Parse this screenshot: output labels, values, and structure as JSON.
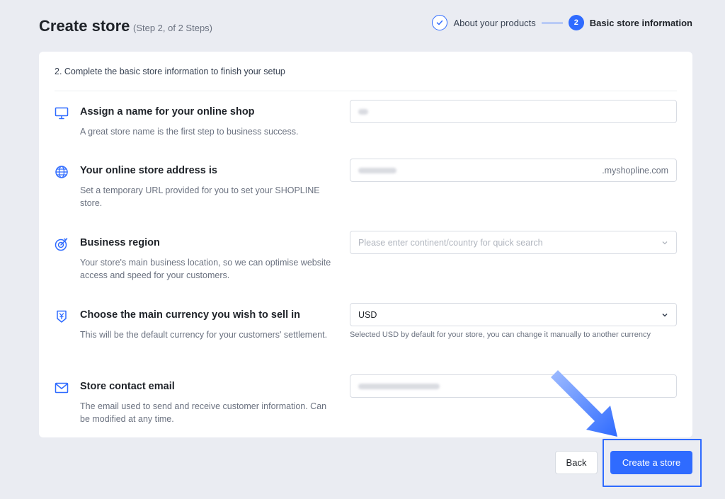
{
  "header": {
    "title": "Create store",
    "step_text": "(Step 2, of 2 Steps)"
  },
  "stepper": {
    "steps": [
      {
        "label": "About your products",
        "status": "done",
        "icon": "check-icon"
      },
      {
        "label": "Basic store information",
        "status": "active",
        "number": "2"
      }
    ]
  },
  "form": {
    "intro": "2. Complete the basic store information to finish your setup",
    "fields": [
      {
        "icon": "monitor-icon",
        "title": "Assign a name for your online shop",
        "description": "A great store name is the first step to business success.",
        "value": ""
      },
      {
        "icon": "globe-icon",
        "title": "Your online store address is",
        "description": "Set a temporary URL provided for you to set your SHOPLINE store.",
        "value": "",
        "suffix": ".myshopline.com"
      },
      {
        "icon": "target-icon",
        "title": "Business region",
        "description": "Your store's main business location, so we can optimise website access and speed for your customers.",
        "placeholder": "Please enter continent/country for quick search"
      },
      {
        "icon": "currency-icon",
        "title": "Choose the main currency you wish to sell in",
        "description": "This will be the default currency for your customers' settlement.",
        "value": "USD",
        "hint": "Selected USD by default for your store, you can change it manually to another currency"
      },
      {
        "icon": "mail-icon",
        "title": "Store contact email",
        "description": "The email used to send and receive customer information. Can be modified at any time.",
        "value": ""
      }
    ]
  },
  "footer": {
    "back_label": "Back",
    "create_label": "Create a store"
  },
  "colors": {
    "accent": "#2f6bff",
    "background": "#eaecf2"
  }
}
